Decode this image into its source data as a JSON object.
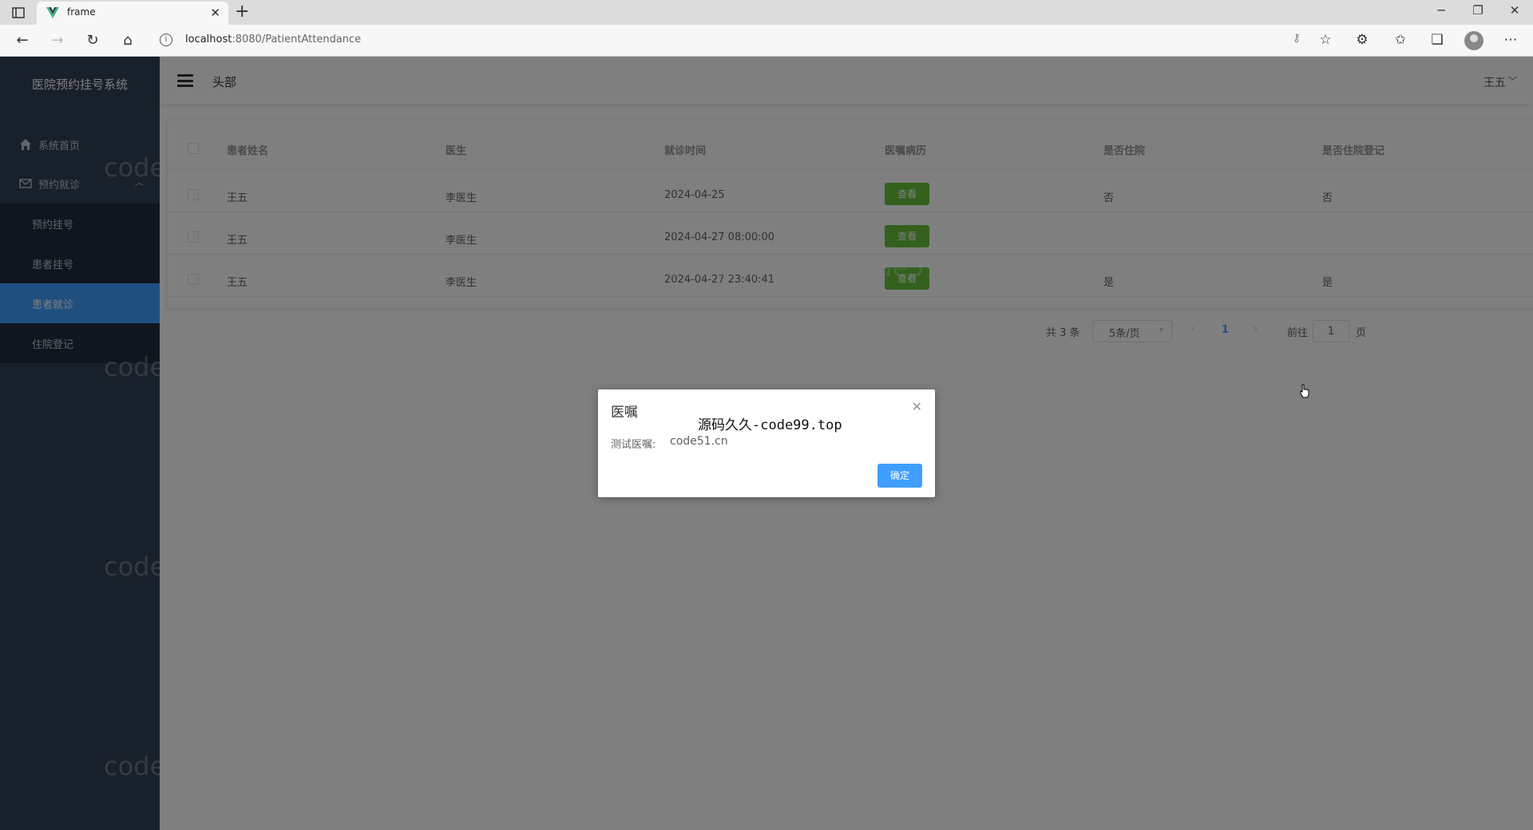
{
  "browser": {
    "tab_title": "frame",
    "url_host": "localhost",
    "url_path": ":8080/PatientAttendance"
  },
  "sidebar": {
    "brand": "医院预约挂号系统",
    "items": [
      {
        "label": "系统首页",
        "icon": "home-icon"
      },
      {
        "label": "预约就诊",
        "icon": "mail-icon"
      }
    ],
    "sub_items": [
      {
        "label": "预约挂号"
      },
      {
        "label": "患者挂号"
      },
      {
        "label": "患者就诊"
      },
      {
        "label": "住院登记"
      }
    ]
  },
  "header": {
    "title": "头部",
    "user": "王五"
  },
  "table": {
    "columns": [
      "患者姓名",
      "医生",
      "就诊时间",
      "医嘱病历",
      "是否住院",
      "是否住院登记"
    ],
    "rows": [
      {
        "name": "王五",
        "doctor": "李医生",
        "time": "2024-04-25",
        "action": "查看",
        "inpatient": "否",
        "registered": "否"
      },
      {
        "name": "王五",
        "doctor": "李医生",
        "time": "2024-04-27 08:00:00",
        "action": "查看",
        "inpatient": "",
        "registered": ""
      },
      {
        "name": "王五",
        "doctor": "李医生",
        "time": "2024-04-27 23:40:41",
        "action": "查看",
        "inpatient": "是",
        "registered": "是"
      }
    ]
  },
  "pagination": {
    "total": "共 3 条",
    "page_size": "5条/页",
    "current": "1",
    "goto": "前往",
    "goto_value": "1",
    "unit": "页"
  },
  "dialog": {
    "title": "医嘱",
    "overlay_text": "源码久久-code99.top",
    "label": "测试医嘱:",
    "value": "code51.cn",
    "ok": "确定"
  },
  "watermark": {
    "text": "code51.cn"
  },
  "colors": {
    "sidebar_bg": "#304156",
    "submenu_bg": "#1f2d3d",
    "active": "#409eff",
    "success": "#67c23a"
  }
}
